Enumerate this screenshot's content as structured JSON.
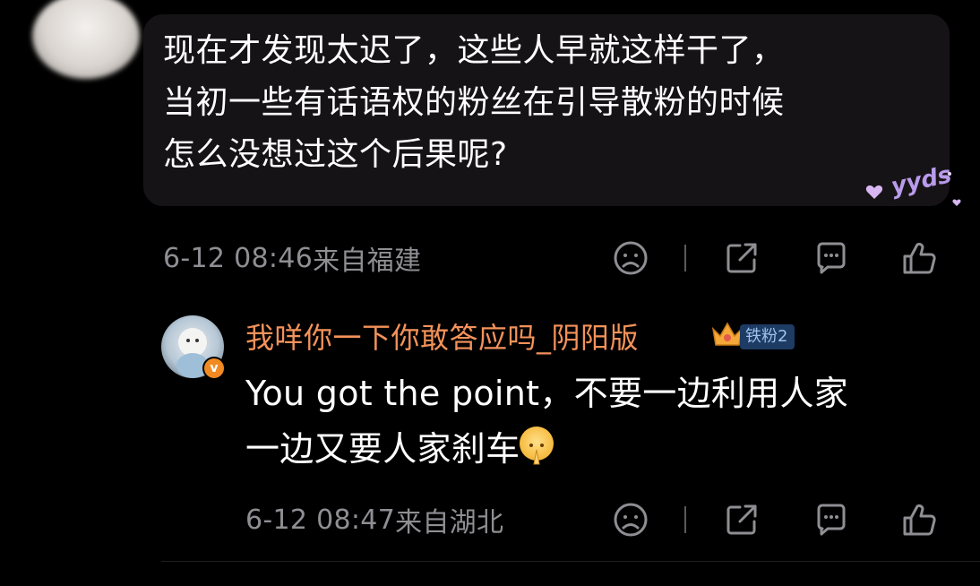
{
  "comment": {
    "text_lines": [
      "现在才发现太迟了，这些人早就这样干了，",
      "当初一些有话语权的粉丝在引导散粉的时候",
      "怎么没想过这个后果呢?"
    ],
    "sticker_text": "yyds",
    "time": "6-12 08:46",
    "location": "来自福建"
  },
  "reply": {
    "username": "我咩你一下你敢答应吗_阴阳版",
    "fan_badge": "铁粉2",
    "vip_badge": "v",
    "text_lines": [
      "You got the point，不要一边利用人家",
      "一边又要人家刹车"
    ],
    "emoji": "pray-emoji",
    "time": "6-12 08:47",
    "location": "来自湖北"
  },
  "actions": [
    "dislike-icon",
    "share-icon",
    "comment-icon",
    "like-icon"
  ],
  "colors": {
    "background": "#000000",
    "bubble": "#161317",
    "username": "#f3925a",
    "meta": "#8e8e93",
    "fan_badge_bg": "#1d3b63",
    "fan_badge_text": "#9ec2ee"
  }
}
